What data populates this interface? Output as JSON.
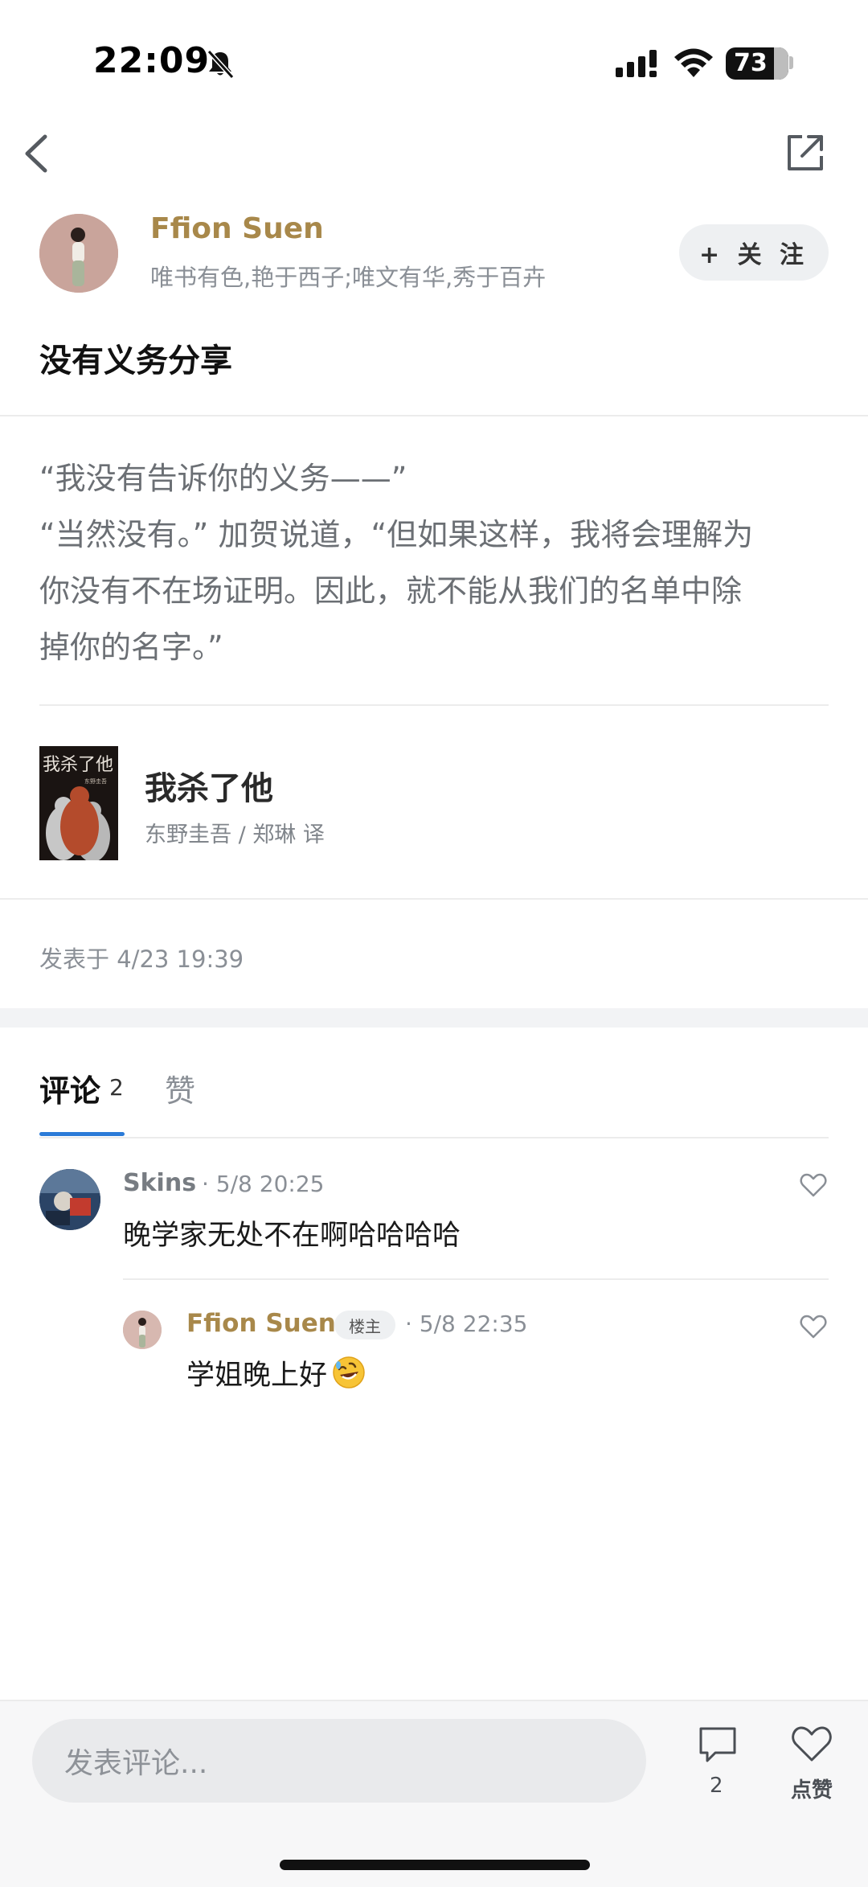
{
  "status_bar": {
    "time": "22:09",
    "battery": "73",
    "icons": [
      "bell-slash-icon",
      "signal-icon",
      "wifi-icon",
      "battery-icon"
    ]
  },
  "nav": {
    "icons": [
      "chevron-left-icon",
      "share-icon"
    ]
  },
  "author": {
    "name": "Ffion Suen",
    "bio": "唯书有色,艳于西子;唯文有华,秀于百卉",
    "follow_label": "+ 关 注",
    "name_color": "#a8884a"
  },
  "post": {
    "title": "没有义务分享",
    "quote_lines": [
      "“我没有告诉你的义务——”",
      "“当然没有。” 加贺说道，“但如果这样，我将会理解为",
      "你没有不在场证明。因此，就不能从我们的名单中除",
      "掉你的名字。”"
    ],
    "book": {
      "title": "我杀了他",
      "author": "东野圭吾 / 郑琳 译",
      "cover_text": "我杀了他",
      "cover_subtext": "东野圭吾"
    },
    "published": "发表于 4/23 19:39"
  },
  "tabs": {
    "comments_label": "评论",
    "comments_count": "2",
    "likes_label": "赞",
    "active_color": "#2b7bd8"
  },
  "comments": [
    {
      "name": "Skins",
      "time": "· 5/8 20:25",
      "text": "晚学家无处不在啊哈哈哈哈"
    }
  ],
  "reply": {
    "name": "Ffion Suen",
    "badge": "楼主",
    "time": "· 5/8 22:35",
    "text": "学姐晚上好"
  },
  "bottom_bar": {
    "input_placeholder": "发表评论...",
    "comment_count": "2",
    "like_label": "点赞"
  }
}
